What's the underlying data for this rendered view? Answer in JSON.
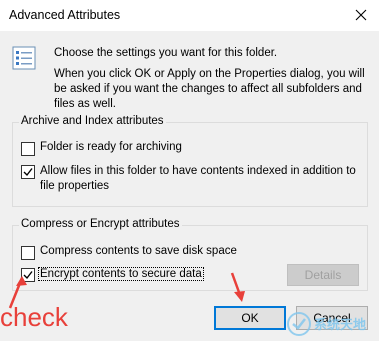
{
  "window": {
    "title": "Advanced Attributes",
    "close_icon": "close-icon"
  },
  "intro": {
    "icon": "folder-settings-icon",
    "line1": "Choose the settings you want for this folder.",
    "line2": "When you click OK or Apply on the Properties dialog, you will be asked if you want the changes to affect all subfolders and files as well."
  },
  "archive_group": {
    "legend": "Archive and Index attributes",
    "items": [
      {
        "label": "Folder is ready for archiving",
        "checked": false
      },
      {
        "label": "Allow files in this folder to have contents indexed in addition to file properties",
        "checked": true
      }
    ]
  },
  "compress_group": {
    "legend": "Compress or Encrypt attributes",
    "items": [
      {
        "label": "Compress contents to save disk space",
        "checked": false
      },
      {
        "label": "Encrypt contents to secure data",
        "checked": true
      }
    ],
    "details_label": "Details"
  },
  "buttons": {
    "ok": "OK",
    "cancel": "Cancel"
  },
  "annotation": {
    "text": "check",
    "color": "#e8403a"
  },
  "watermark": {
    "text": "系统天地"
  },
  "colors": {
    "accent": "#0078d7",
    "annotation": "#e8403a"
  }
}
